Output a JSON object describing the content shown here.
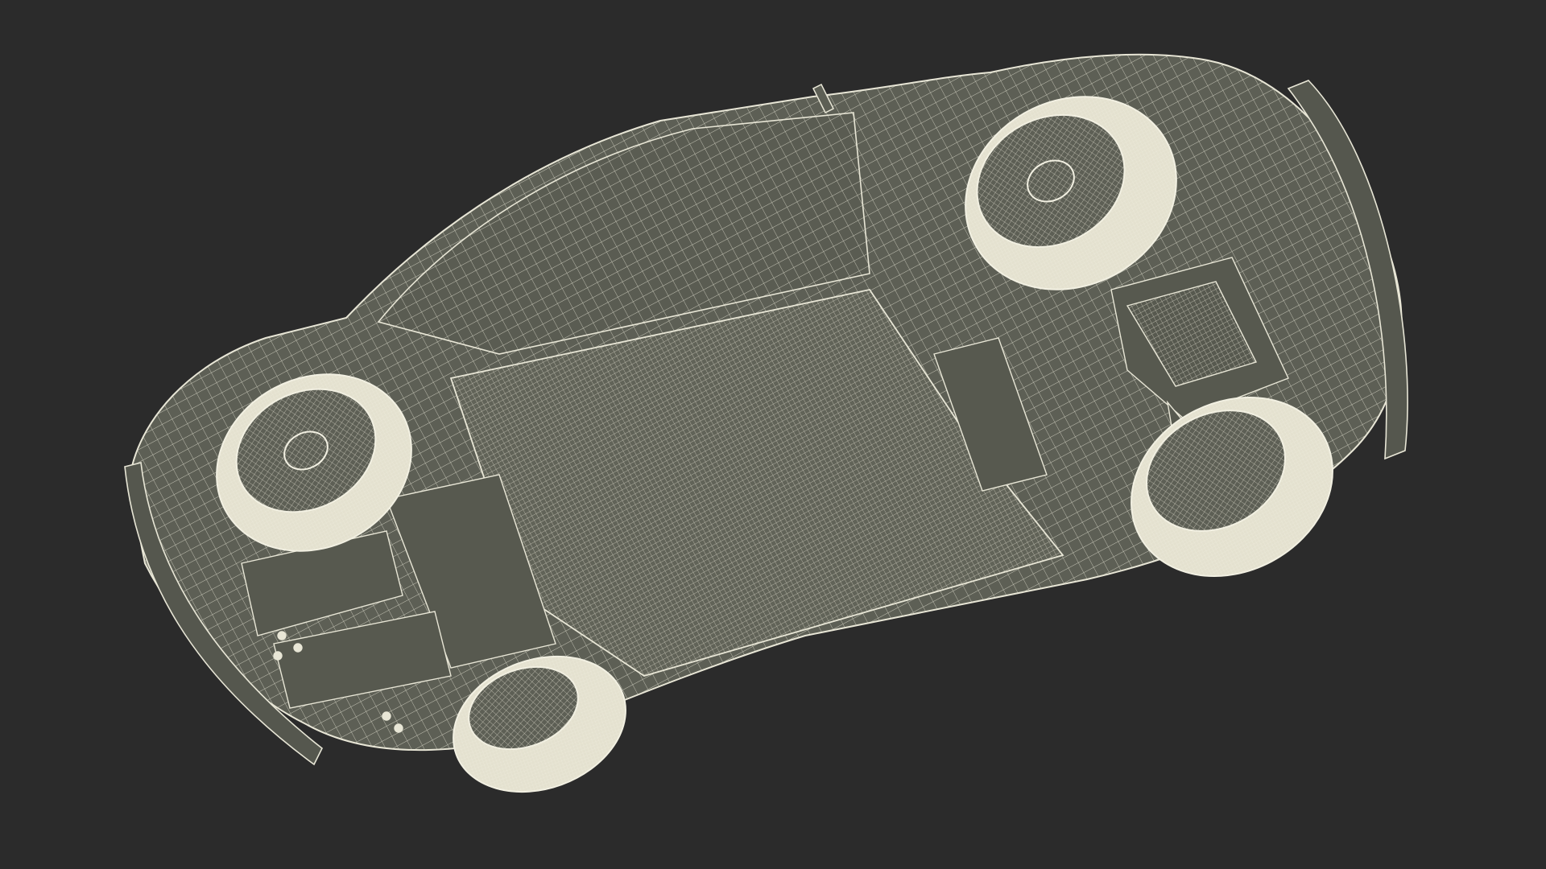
{
  "scene": {
    "background_color": "#2b2b2b",
    "surface_fill": "#5d5f55",
    "surface_fill_dark": "#4f5148",
    "wire_color": "#e8e6d6",
    "subject": "car-underside-wireframe"
  }
}
